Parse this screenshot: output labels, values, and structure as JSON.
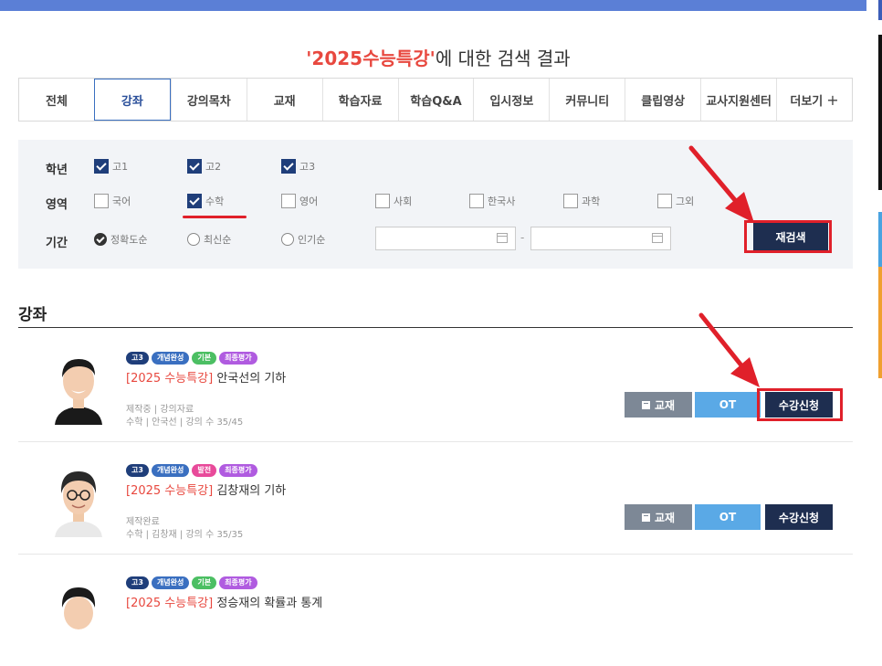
{
  "header": {
    "search_keyword": "'2025수능특강'",
    "search_suffix": "에 대한 검색 결과"
  },
  "tabs": [
    {
      "label": "전체"
    },
    {
      "label": "강좌"
    },
    {
      "label": "강의목차"
    },
    {
      "label": "교재"
    },
    {
      "label": "학습자료"
    },
    {
      "label": "학습Q&A"
    },
    {
      "label": "입시정보"
    },
    {
      "label": "커뮤니티"
    },
    {
      "label": "클립영상"
    },
    {
      "label": "교사지원센터"
    },
    {
      "label": "더보기"
    }
  ],
  "active_tab": "강좌",
  "filter": {
    "grade_label": "학년",
    "grades": [
      {
        "label": "고1",
        "checked": true
      },
      {
        "label": "고2",
        "checked": true
      },
      {
        "label": "고3",
        "checked": true
      }
    ],
    "area_label": "영역",
    "areas": [
      {
        "label": "국어",
        "checked": false
      },
      {
        "label": "수학",
        "checked": true
      },
      {
        "label": "영어",
        "checked": false
      },
      {
        "label": "사회",
        "checked": false
      },
      {
        "label": "한국사",
        "checked": false
      },
      {
        "label": "과학",
        "checked": false
      },
      {
        "label": "그외",
        "checked": false
      }
    ],
    "period_label": "기간",
    "sorts": [
      {
        "label": "정확도순",
        "selected": true
      },
      {
        "label": "최신순",
        "selected": false
      },
      {
        "label": "인기순",
        "selected": false
      }
    ],
    "date_separator": "-",
    "research_button": "재검색"
  },
  "section_title": "강좌",
  "courses": [
    {
      "badges": [
        {
          "label": "고3",
          "color": "#1f3e7a"
        },
        {
          "label": "개념완성",
          "color": "#3a6fc0"
        },
        {
          "label": "기본",
          "color": "#4cbf63"
        },
        {
          "label": "최종평가",
          "color": "#b05be0"
        }
      ],
      "title_bracket_open": "[",
      "title_keyword": "2025 수능특강",
      "title_bracket_close": "]",
      "title_rest": " 안국선의 기하",
      "status": "제작중",
      "extra": "강의자료",
      "subject": "수학",
      "teacher": "안국선",
      "lecture_count": "강의 수 35/45",
      "buttons": {
        "book": "교재",
        "ot": "OT",
        "apply": "수강신청"
      }
    },
    {
      "badges": [
        {
          "label": "고3",
          "color": "#1f3e7a"
        },
        {
          "label": "개념완성",
          "color": "#3a6fc0"
        },
        {
          "label": "발전",
          "color": "#e84a9a"
        },
        {
          "label": "최종평가",
          "color": "#b05be0"
        }
      ],
      "title_bracket_open": "[",
      "title_keyword": "2025 수능특강",
      "title_bracket_close": "]",
      "title_rest": " 김창재의 기하",
      "status": "제작완료",
      "subject": "수학",
      "teacher": "김창재",
      "lecture_count": "강의 수 35/35",
      "buttons": {
        "book": "교재",
        "ot": "OT",
        "apply": "수강신청"
      }
    },
    {
      "badges": [
        {
          "label": "고3",
          "color": "#1f3e7a"
        },
        {
          "label": "개념완성",
          "color": "#3a6fc0"
        },
        {
          "label": "기본",
          "color": "#4cbf63"
        },
        {
          "label": "최종평가",
          "color": "#b05be0"
        }
      ],
      "title_bracket_open": "[",
      "title_keyword": "2025 수능특강",
      "title_bracket_close": "]",
      "title_rest": " 정승재의 확률과 통계"
    }
  ],
  "colors": {
    "accent": "#e8483f",
    "navy": "#1e2e50",
    "annotation_red": "#e0202a",
    "topbar": "#5b7fd6"
  }
}
